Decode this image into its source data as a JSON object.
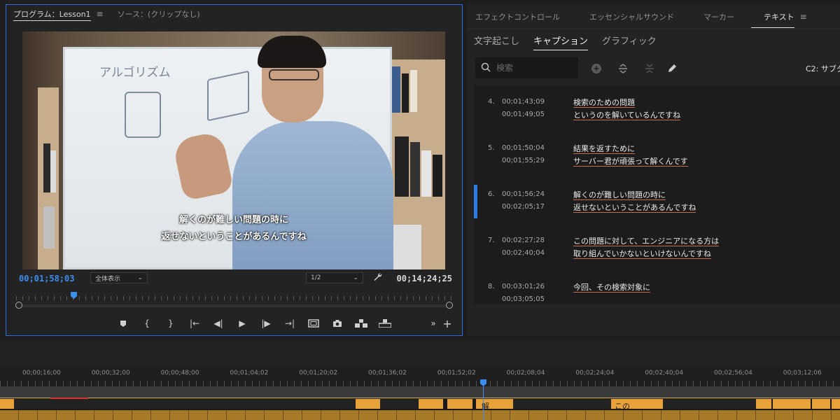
{
  "program": {
    "tab_program": "プログラム：Lesson1",
    "tab_source": "ソース：(クリップなし)",
    "menu_icon": "≡",
    "timecode_current": "00;01;58;03",
    "timecode_duration": "00;14;24;25",
    "zoom_select": "全体表示",
    "resolution_select": "1/2",
    "subtitle_line1": "解くのが難しい問題の時に",
    "subtitle_line2": "返せないということがあるんですね",
    "board_text": "アルゴリズム"
  },
  "right_panel": {
    "tabs": [
      "エフェクトコントロール",
      "エッセンシャルサウンド",
      "マーカー",
      "テキスト"
    ],
    "menu_icon": "≡",
    "sub_tabs": [
      "文字起こし",
      "キャプション",
      "グラフィック"
    ],
    "search_placeholder": "検索",
    "track_label": "C2: サブタ"
  },
  "captions": [
    {
      "num": "4.",
      "in": "00;01;43;09",
      "out": "00;01;49;05",
      "line1": "検索のための問題",
      "line2": "というのを解いているんですね",
      "selected": false
    },
    {
      "num": "5.",
      "in": "00;01;50;04",
      "out": "00;01;55;29",
      "line1": "結果を返すために",
      "line2": "サーバー君が頑張って解くんです",
      "selected": false
    },
    {
      "num": "6.",
      "in": "00;01;56;24",
      "out": "00;02;05;17",
      "line1": "解くのが難しい問題の時に",
      "line2": "返せないということがあるんですね",
      "selected": true
    },
    {
      "num": "7.",
      "in": "00;02;27;28",
      "out": "00;02;40;04",
      "line1": "この問題に対して、エンジニアになる方は",
      "line2": "取り組んでいかないといけないんですね",
      "selected": false
    },
    {
      "num": "8.",
      "in": "00;03;01;26",
      "out": "00;03;05;05",
      "line1": "今回、その検索対象に",
      "line2": "",
      "selected": false
    }
  ],
  "timeline": {
    "labels": [
      "00;00;16;00",
      "00;00;32;00",
      "00;00;48;00",
      "00;01;04;02",
      "00;01;20;02",
      "00;01;36;02",
      "00;01;52;02",
      "00;02;08;04",
      "00;02;24;04",
      "00;02;40;04",
      "00;02;56;04",
      "00;03;12;06"
    ],
    "clip_text_1": "解",
    "clip_text_2": "この"
  },
  "colors": {
    "accent_blue": "#2d7de6",
    "caption_clip": "#e7a33a"
  }
}
